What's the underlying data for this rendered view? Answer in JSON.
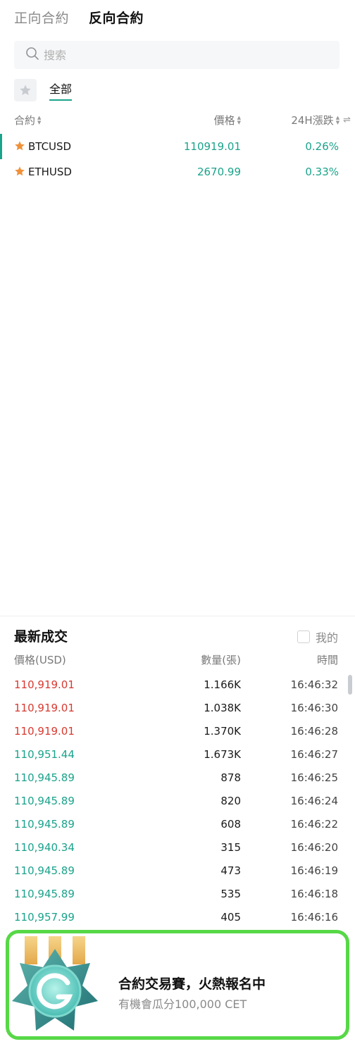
{
  "tabs": {
    "forward": "正向合約",
    "inverse": "反向合約"
  },
  "search": {
    "placeholder": "搜索"
  },
  "category": {
    "all": "全部"
  },
  "columns": {
    "contract": "合約",
    "price": "價格",
    "change": "24H漲跌"
  },
  "markets": [
    {
      "symbol": "BTCUSD",
      "price": "110919.01",
      "change": "0.26%"
    },
    {
      "symbol": "ETHUSD",
      "price": "2670.99",
      "change": "0.33%"
    }
  ],
  "trades": {
    "title": "最新成交",
    "mine_label": "我的",
    "headers": {
      "price": "價格(USD)",
      "qty": "數量(張)",
      "time": "時間"
    },
    "rows": [
      {
        "price": "110,919.01",
        "qty": "1.166K",
        "time": "16:46:32",
        "side": "down"
      },
      {
        "price": "110,919.01",
        "qty": "1.038K",
        "time": "16:46:30",
        "side": "down"
      },
      {
        "price": "110,919.01",
        "qty": "1.370K",
        "time": "16:46:28",
        "side": "down"
      },
      {
        "price": "110,951.44",
        "qty": "1.673K",
        "time": "16:46:27",
        "side": "up"
      },
      {
        "price": "110,945.89",
        "qty": "878",
        "time": "16:46:25",
        "side": "up"
      },
      {
        "price": "110,945.89",
        "qty": "820",
        "time": "16:46:24",
        "side": "up"
      },
      {
        "price": "110,945.89",
        "qty": "608",
        "time": "16:46:22",
        "side": "up"
      },
      {
        "price": "110,940.34",
        "qty": "315",
        "time": "16:46:20",
        "side": "up"
      },
      {
        "price": "110,945.89",
        "qty": "473",
        "time": "16:46:19",
        "side": "up"
      },
      {
        "price": "110,945.89",
        "qty": "535",
        "time": "16:46:18",
        "side": "up"
      },
      {
        "price": "110,957.99",
        "qty": "405",
        "time": "16:46:16",
        "side": "up"
      }
    ]
  },
  "banner": {
    "title": "合約交易賽，火熱報名中",
    "subtitle": "有機會瓜分100,000 CET"
  },
  "colors": {
    "accent": "#1aa38b",
    "down": "#d8392f",
    "star": "#f0913a",
    "banner_border": "#57d847"
  },
  "icons": {
    "search": "search-icon",
    "favorite": "star-icon",
    "sort": "sort-icon",
    "medal": "medal-icon"
  }
}
